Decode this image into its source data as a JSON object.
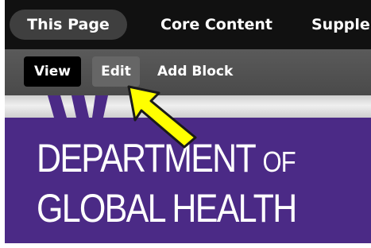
{
  "tabs": {
    "this_page": "This Page",
    "core_content": "Core Content",
    "supplemental": "Supple"
  },
  "toolbar": {
    "view_label": "View",
    "edit_label": "Edit",
    "add_block_label": "Add Block"
  },
  "banner": {
    "line1_main": "DEPARTMENT ",
    "line1_small": "OF",
    "line2": "GLOBAL HEALTH"
  },
  "annotation": {
    "arrow_icon": "yellow-arrow-icon",
    "arrow_color": "#ffff00"
  },
  "colors": {
    "tabbar": "#111111",
    "toolbar": "#4f4f4f",
    "banner_purple": "#4b2a86"
  }
}
